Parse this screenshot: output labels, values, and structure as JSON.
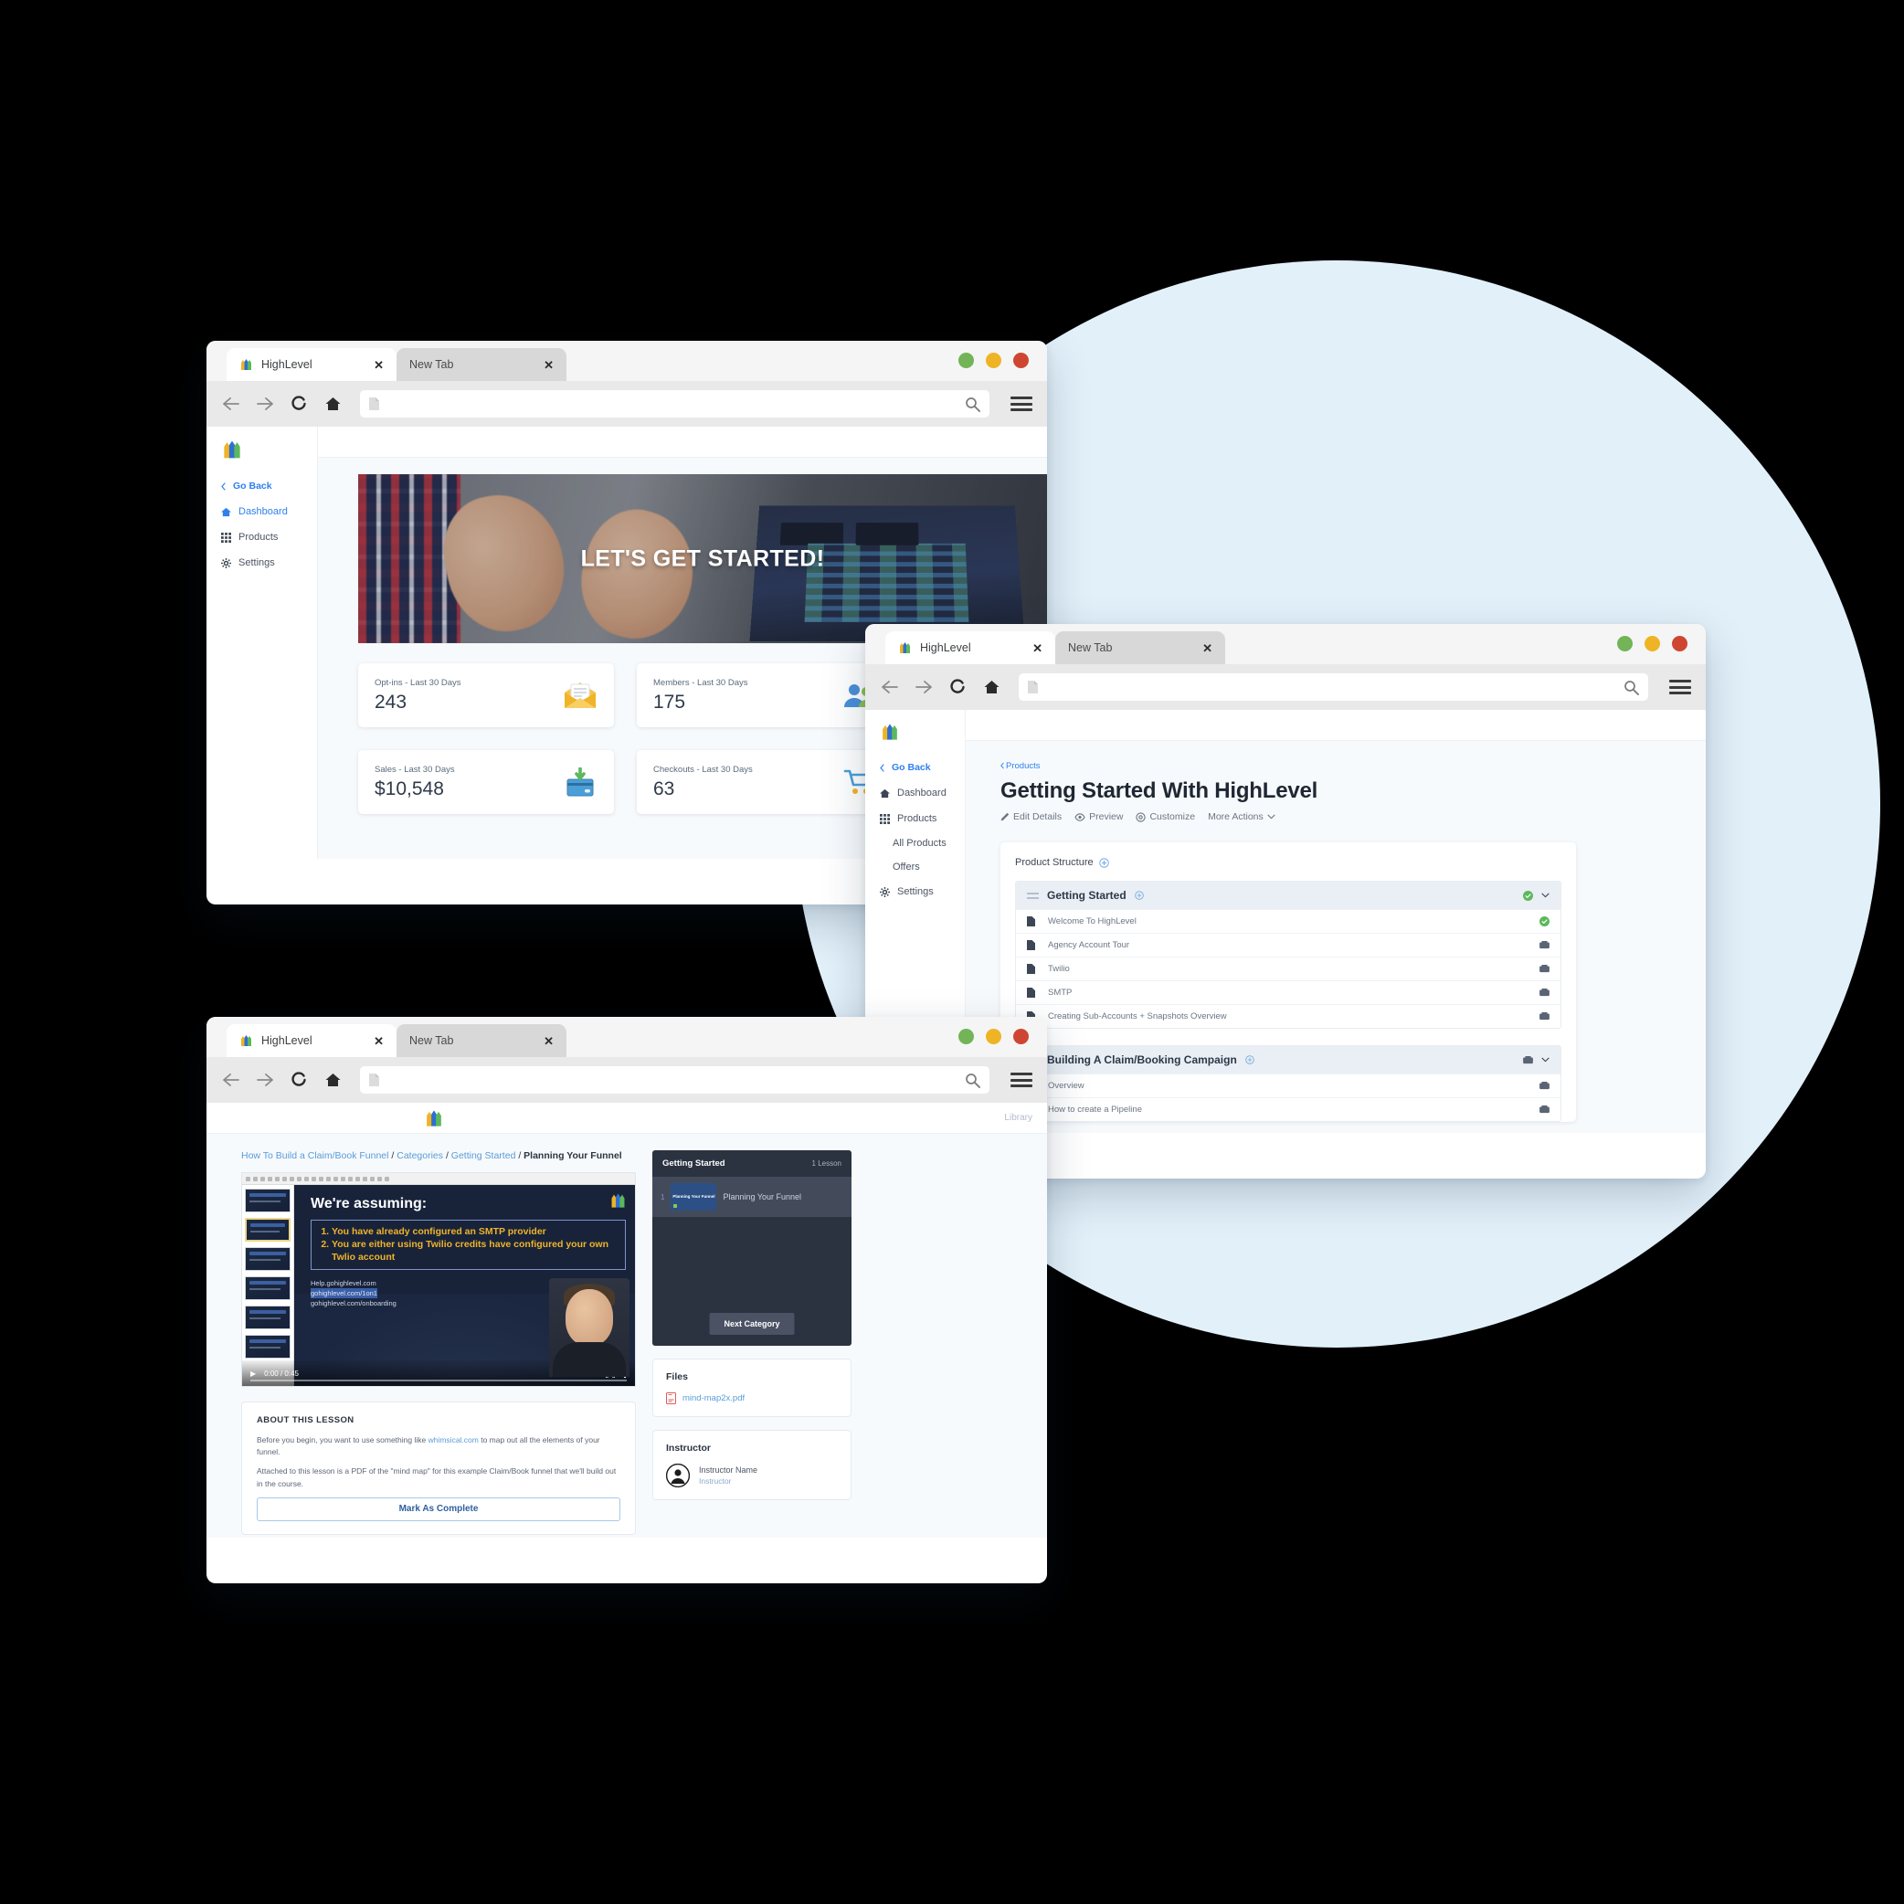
{
  "theme": {
    "accent": "#2f80ed",
    "bg_circle": "#e2f0f9",
    "page_bg": "#000000",
    "link": "#5a9bd8"
  },
  "browser": {
    "tab_active": "HighLevel",
    "tab_inactive": "New Tab",
    "close_glyph": "✕",
    "url_value": "",
    "url_placeholder": "",
    "controls": {
      "green": "#72b457",
      "yellow": "#eeb425",
      "red": "#ce4631"
    }
  },
  "window1": {
    "sidebar": {
      "go_back": "Go Back",
      "items": [
        {
          "label": "Dashboard",
          "icon": "home-icon"
        },
        {
          "label": "Products",
          "icon": "grid-icon"
        },
        {
          "label": "Settings",
          "icon": "gear-icon"
        }
      ]
    },
    "hero": {
      "title": "LET'S GET STARTED!"
    },
    "stats": [
      {
        "label": "Opt-ins - Last 30 Days",
        "value": "243",
        "icon": "envelope-icon"
      },
      {
        "label": "Members - Last 30 Days",
        "value": "175",
        "icon": "users-icon"
      },
      {
        "label": "Sales - Last 30 Days",
        "value": "$10,548",
        "icon": "card-download-icon"
      },
      {
        "label": "Checkouts - Last 30 Days",
        "value": "63",
        "icon": "cart-icon"
      }
    ]
  },
  "window2": {
    "sidebar": {
      "go_back": "Go Back",
      "items": [
        {
          "label": "Dashboard",
          "icon": "home-icon"
        },
        {
          "label": "Products",
          "icon": "grid-icon"
        },
        {
          "label": "All Products",
          "icon": ""
        },
        {
          "label": "Offers",
          "icon": ""
        },
        {
          "label": "Settings",
          "icon": "gear-icon"
        }
      ]
    },
    "breadcrumb": "Products",
    "title": "Getting Started With HighLevel",
    "actions": [
      {
        "label": "Edit Details",
        "icon": "pencil-icon"
      },
      {
        "label": "Preview",
        "icon": "eye-icon"
      },
      {
        "label": "Customize",
        "icon": "palette-icon"
      },
      {
        "label": "More Actions",
        "icon": "chevron-down-icon"
      }
    ],
    "structure_title": "Product Structure",
    "groups": [
      {
        "name": "Getting Started",
        "status": "complete",
        "lessons": [
          {
            "name": "Welcome To HighLevel",
            "status": "complete"
          },
          {
            "name": "Agency Account Tour",
            "status": "video"
          },
          {
            "name": "Twilio",
            "status": "video"
          },
          {
            "name": "SMTP",
            "status": "video"
          },
          {
            "name": "Creating Sub-Accounts + Snapshots Overview",
            "status": "video"
          }
        ]
      },
      {
        "name": "Building A Claim/Booking Campaign",
        "status": "video",
        "lessons": [
          {
            "name": "Overview",
            "status": "video"
          },
          {
            "name": "How to create a Pipeline",
            "status": "video"
          }
        ]
      }
    ]
  },
  "window3": {
    "library_label": "Library",
    "breadcrumb": {
      "parts": [
        "How To Build a Claim/Book Funnel",
        "Categories",
        "Getting Started"
      ],
      "current": "Planning Your Funnel",
      "separator": "/"
    },
    "slide": {
      "heading": "We're assuming:",
      "bullets": [
        "You have already configured an SMTP provider",
        "You are either using Twilio credits have configured your own Twlio account"
      ],
      "links": [
        "Help.gohighlevel.com",
        "gohighlevel.com/1on1",
        "gohighlevel.com/onboarding"
      ]
    },
    "player": {
      "time": "0:00 / 0:45",
      "play_glyph": "▶"
    },
    "about": {
      "heading": "ABOUT THIS LESSON",
      "p1_before": "Before you begin, you want to use something like ",
      "p1_link": "whimsical.com",
      "p1_after": " to map out all the elements of your funnel.",
      "p2": "Attached to this lesson is a PDF of the \"mind map\" for this example Claim/Book funnel that we'll build out in the course.",
      "button": "Mark As Complete"
    },
    "category": {
      "title": "Getting Started",
      "count": "1 Lesson",
      "lesson_number": "1",
      "lesson_thumb_label": "Planning Your Funnel",
      "lesson_name": "Planning Your Funnel",
      "next_button": "Next Category"
    },
    "files": {
      "heading": "Files",
      "items": [
        {
          "name": "mind-map2x.pdf",
          "icon": "pdf-icon"
        }
      ]
    },
    "instructor": {
      "heading": "Instructor",
      "name": "Instructor Name",
      "role": "Instructor"
    }
  }
}
